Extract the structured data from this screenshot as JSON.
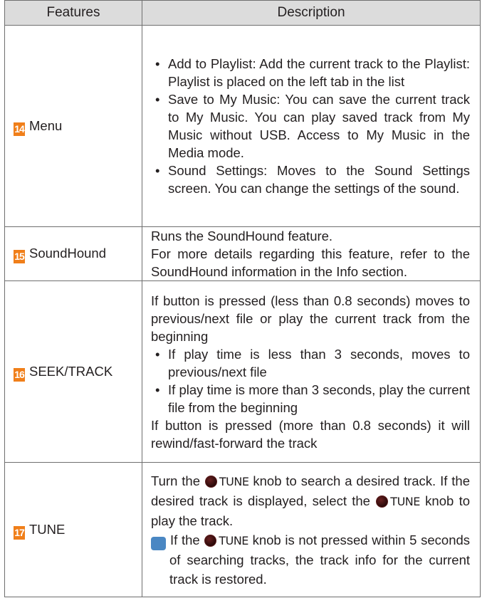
{
  "header": {
    "features": "Features",
    "description": "Description"
  },
  "rows": [
    {
      "num": "14",
      "feature": "Menu",
      "bullets": [
        "Add to Playlist: Add the current track to the Playlist: Playlist is placed on the left tab in the list",
        "Save to My Music: You can save the current track to My Music. You can play saved track from My Music without USB. Access to My Music in the Media mode.",
        "Sound Settings: Moves to the Sound Settings screen. You can change the settings of the sound."
      ]
    },
    {
      "num": "15",
      "feature": "SoundHound",
      "text": [
        "Runs the SoundHound feature.",
        "For more details regarding this feature, refer to the SoundHound information in the Info section."
      ]
    },
    {
      "num": "16",
      "feature": "SEEK/TRACK",
      "text_before": "If button is pressed (less than 0.8 seconds) moves to previous/next file or play the current track from the beginning",
      "bullets": [
        "If play time is less than 3 seconds, moves to previous/next file",
        "If play time is more than 3 seconds, play the current file from the beginning"
      ],
      "text_after": "If button is pressed (more than 0.8 seconds) it will rewind/fast-forward the track"
    },
    {
      "num": "17",
      "feature": "TUNE",
      "knob_label": "TUNE",
      "p1_a": "Turn the",
      "p1_b": "knob to search a desired track. If the desired track is displayed, select the",
      "p1_c": "knob to play the track.",
      "note_a": "If the",
      "note_b": "knob is not pressed within 5 seconds of searching tracks, the track info for the current track is restored.",
      "info_icon_text": "i"
    }
  ],
  "colors": {
    "badge": "#f07f1a",
    "header_bg": "#dcdcdc",
    "info_icon": "#4a87c3",
    "knob": "#3a0f0f"
  },
  "icons": [
    "tune-knob-icon",
    "info-icon"
  ]
}
